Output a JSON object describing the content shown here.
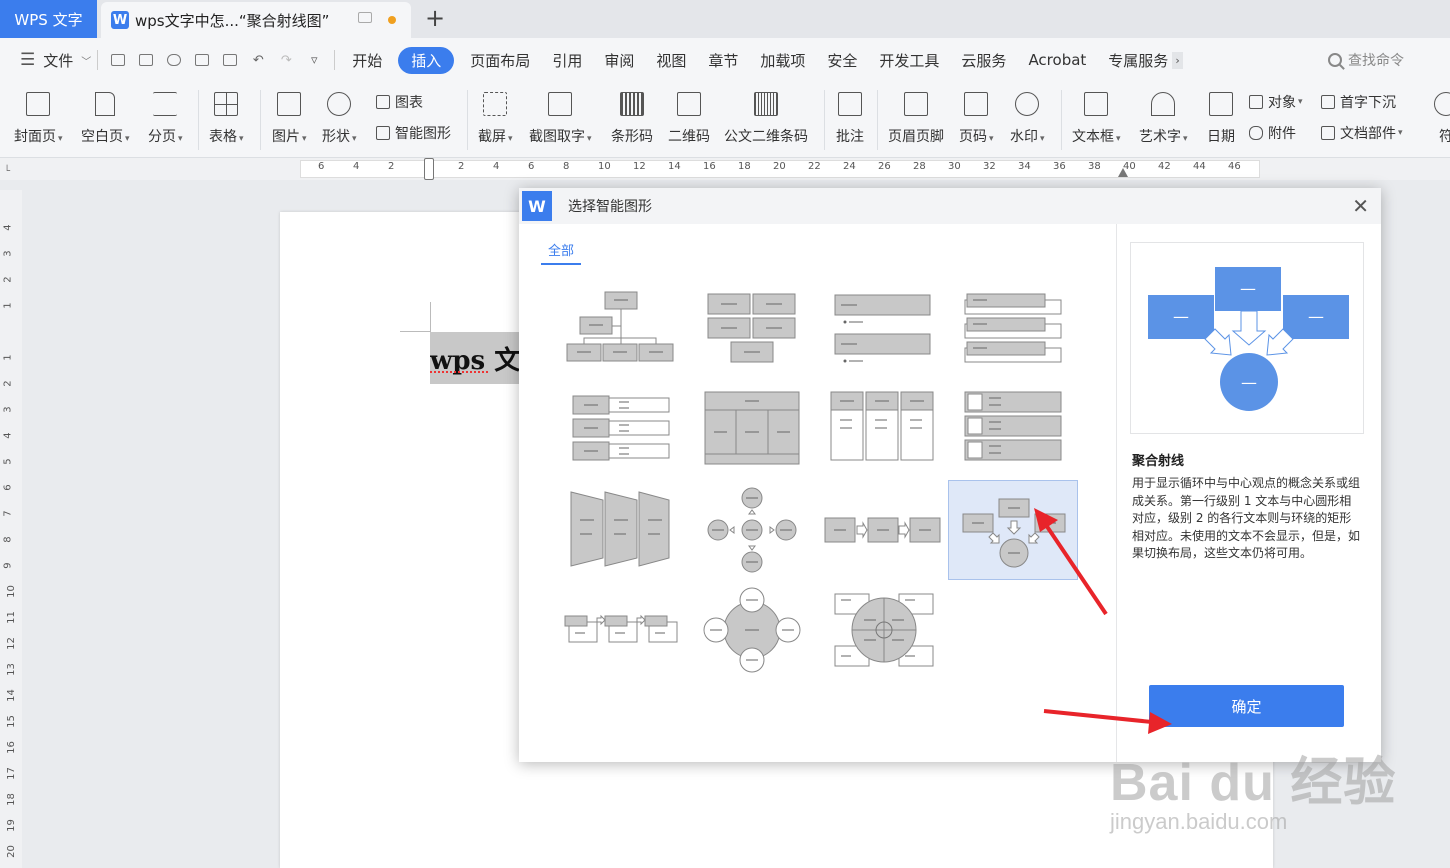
{
  "tabs": {
    "app_label": "WPS 文字",
    "doc_label": "wps文字中怎...“聚合射线图”"
  },
  "menu": {
    "file_label": "文件",
    "items": [
      "开始",
      "插入",
      "页面布局",
      "引用",
      "审阅",
      "视图",
      "章节",
      "加载项",
      "安全",
      "开发工具",
      "云服务",
      "Acrobat",
      "专属服务"
    ],
    "active": "插入",
    "search_placeholder": "查找命令"
  },
  "ribbon": {
    "cover": "封面页",
    "blank": "空白页",
    "pagebreak": "分页",
    "table": "表格",
    "picture": "图片",
    "shape": "形状",
    "chart": "图表",
    "smartart": "智能图形",
    "screenshot": "截屏",
    "ocr": "截图取字",
    "barcode": "条形码",
    "qrcode": "二维码",
    "pdf417": "公文二维条码",
    "comment": "批注",
    "header_footer": "页眉页脚",
    "page_number": "页码",
    "watermark": "水印",
    "textbox": "文本框",
    "wordart": "艺术字",
    "date": "日期",
    "object": "对象",
    "dropcap": "首字下沉",
    "attachment": "附件",
    "doc_parts": "文档部件"
  },
  "ruler": {
    "h_ticks": [
      "6",
      "4",
      "2",
      "",
      "2",
      "4",
      "6",
      "8",
      "10",
      "12",
      "14",
      "16",
      "18",
      "20",
      "22",
      "24",
      "26",
      "28",
      "30",
      "32",
      "34",
      "36",
      "38",
      "40",
      "42",
      "44",
      "46"
    ],
    "v_ticks": [
      "4",
      "3",
      "2",
      "1",
      "",
      "1",
      "2",
      "3",
      "4",
      "5",
      "6",
      "7",
      "8",
      "9",
      "10",
      "11",
      "12",
      "13",
      "14",
      "15",
      "16",
      "17",
      "18",
      "19",
      "20"
    ]
  },
  "document": {
    "text": "wps 文"
  },
  "dialog": {
    "title": "选择智能图形",
    "logo": "W",
    "filter_all": "全部",
    "selected_name": "聚合射线",
    "selected_desc": "用于显示循环中与中心观点的概念关系或组成关系。第一行级别 1 文本与中心圆形相对应，级别 2 的各行文本则与环绕的矩形相对应。未使用的文本不会显示，但是，如果切换布局，这些文本仍将可用。",
    "ok_label": "确定",
    "preview_dash": "—"
  },
  "watermark": {
    "main": "Bai du 经验",
    "sub": "jingyan.baidu.com"
  },
  "colors": {
    "accent": "#3b7ded",
    "arrow": "#e8242a",
    "shape_fill": "#c8c8c8",
    "preview_fill": "#5b93e6"
  }
}
